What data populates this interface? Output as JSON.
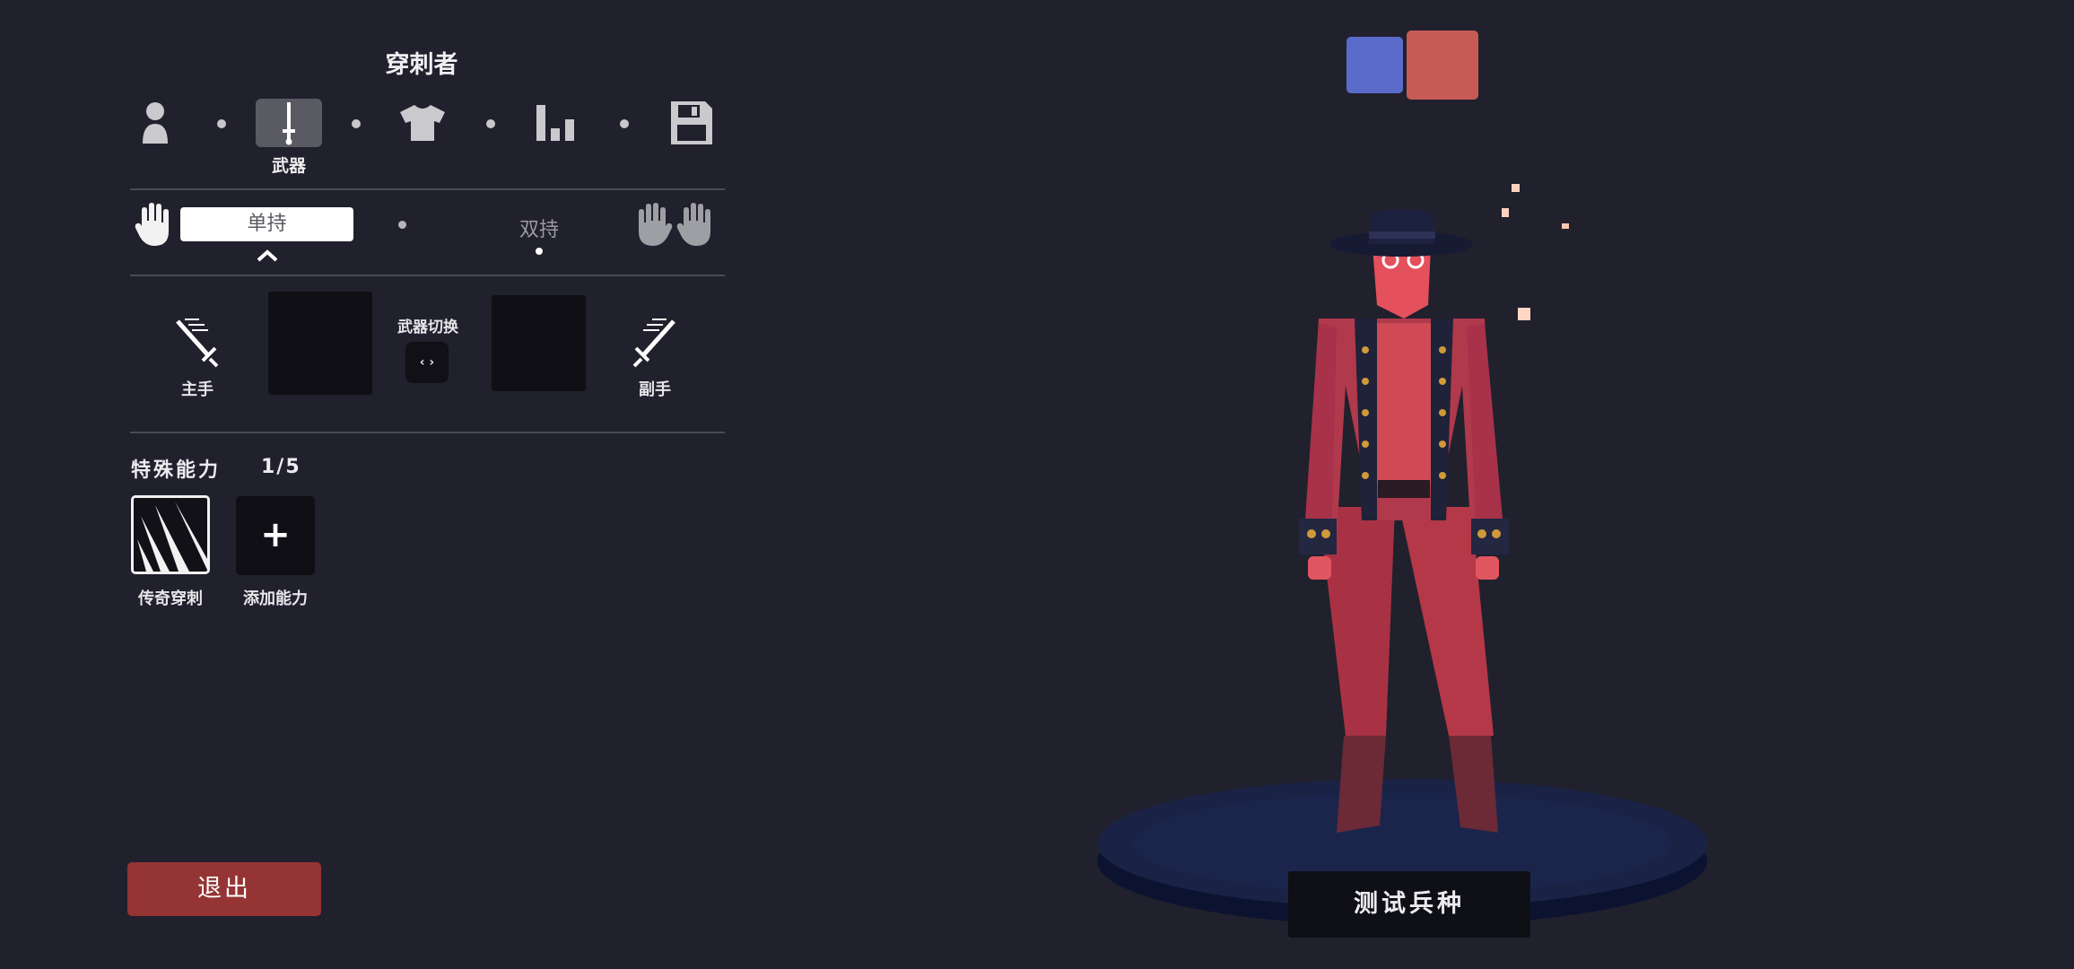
{
  "editor": {
    "unit_title": "穿刺者",
    "steps": [
      {
        "icon": "person-icon",
        "label": "",
        "active": false
      },
      {
        "icon": "sword-icon",
        "label": "武器",
        "active": true
      },
      {
        "icon": "shirt-icon",
        "label": "",
        "active": false
      },
      {
        "icon": "stats-bar-icon",
        "label": "",
        "active": false
      },
      {
        "icon": "save-floppy-icon",
        "label": "",
        "active": false
      }
    ],
    "grip": {
      "one_handed_label": "单持",
      "two_handed_label": "双持",
      "selected": "one_handed"
    },
    "weapons": {
      "main_hand_label": "主手",
      "off_hand_label": "副手",
      "swap_label": "武器切换",
      "swap_button_glyph": "‹ ›"
    },
    "abilities": {
      "title": "特殊能力",
      "count": "1/5",
      "items": [
        {
          "label": "传奇穿刺",
          "icon": "legendary-pierce-icon"
        },
        {
          "label": "添加能力",
          "icon": "plus-icon",
          "glyph": "+"
        }
      ]
    },
    "exit_label": "退出"
  },
  "preview": {
    "team_colors": [
      "#5a6bc9",
      "#c65b56"
    ],
    "unit_name": "测试兵种"
  }
}
